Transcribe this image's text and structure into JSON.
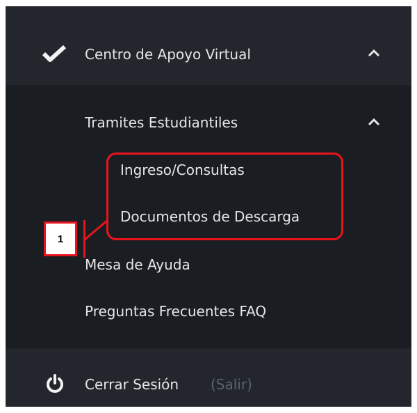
{
  "menu": {
    "parent": {
      "label": "Centro de Apoyo Virtual",
      "icon": "check-icon",
      "toggle_icon": "chevron-up-icon"
    },
    "submenu": {
      "label": "Tramites Estudiantiles",
      "toggle_icon": "chevron-up-icon",
      "items": [
        {
          "label": "Ingreso/Consultas"
        },
        {
          "label": "Documentos de Descarga"
        }
      ]
    },
    "items": [
      {
        "label": "Mesa de Ayuda"
      },
      {
        "label": "Preguntas Frecuentes FAQ"
      }
    ],
    "logout": {
      "label": "Cerrar Sesión",
      "hint": "(Salir)",
      "icon": "power-icon"
    }
  },
  "annotation": {
    "number": "1",
    "color": "#e8141e"
  }
}
